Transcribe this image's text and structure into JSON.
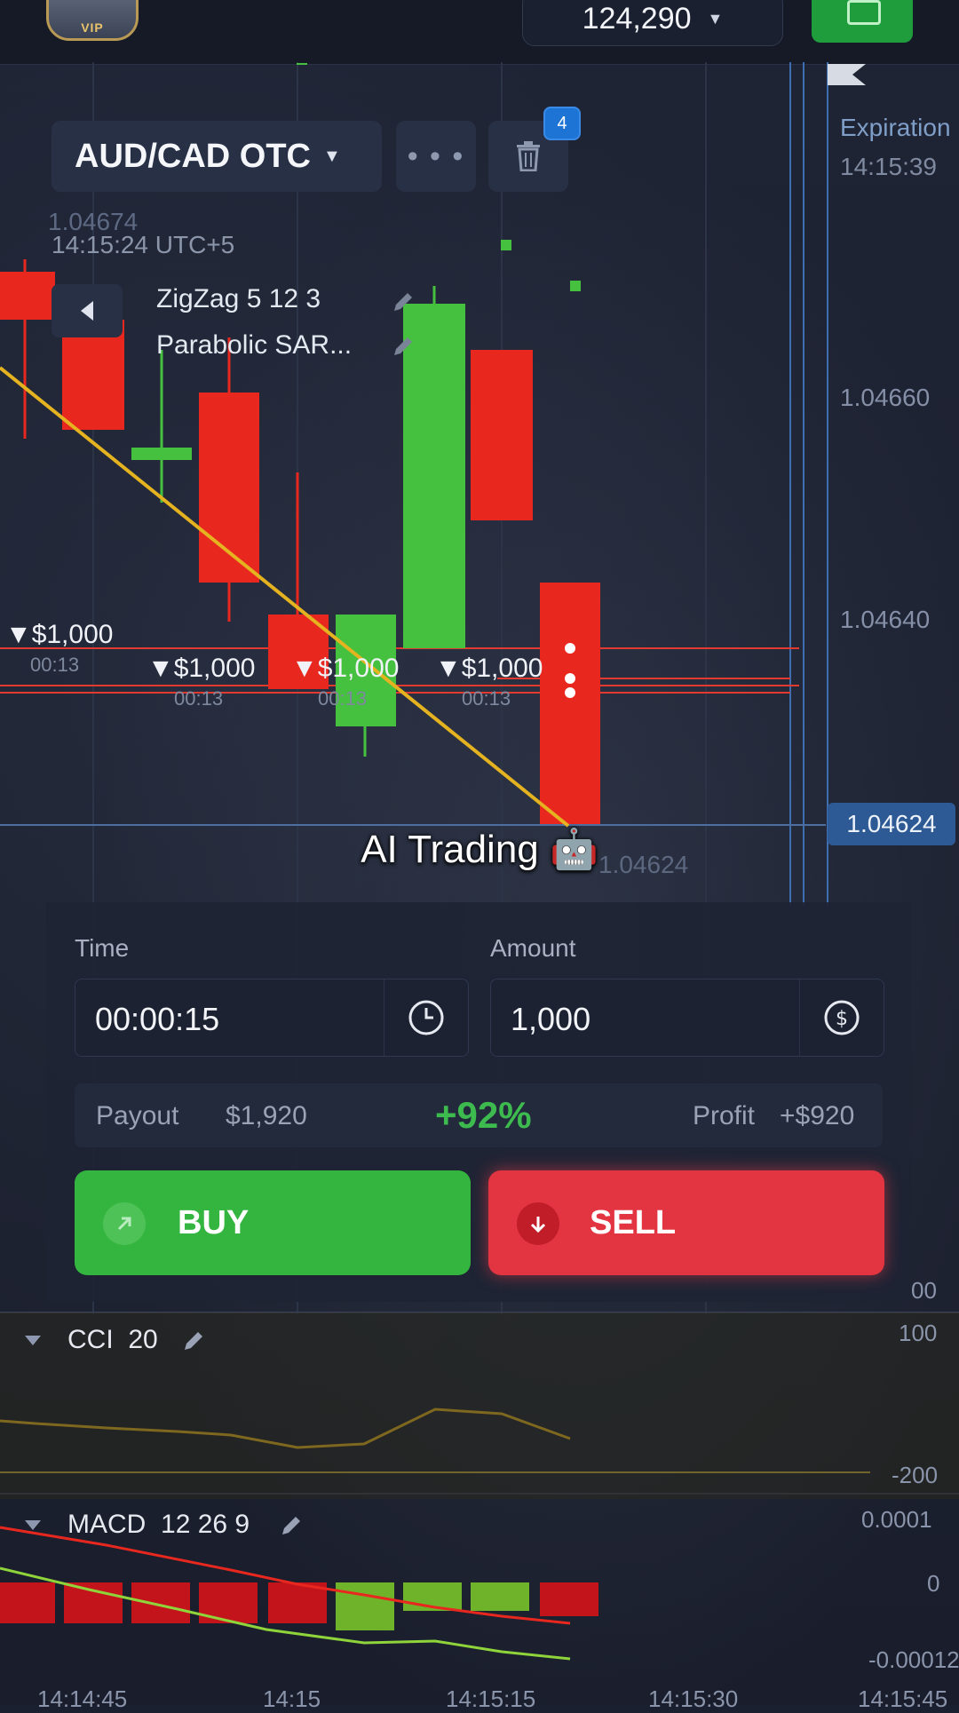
{
  "header": {
    "balance": "124,290",
    "vip_label": "VIP"
  },
  "asset": {
    "name": "AUD/CAD OTC",
    "menu_dots": "• • •",
    "badge_count": "4"
  },
  "expiration": {
    "label": "Expiration",
    "time": "14:15:39"
  },
  "chart_info": {
    "price_top": "1.04674",
    "timestamp": "14:15:24 UTC+5"
  },
  "indicators_overlay": [
    "ZigZag 5 12 3",
    "Parabolic SAR..."
  ],
  "price_axis": [
    "1.04660",
    "1.04640",
    "1.04624"
  ],
  "price_current": "1.04624",
  "price_ghost": "1.04624",
  "bets": [
    {
      "amount": "▼$1,000",
      "time": "00:13"
    },
    {
      "amount": "▼$1,000",
      "time": "00:13"
    },
    {
      "amount": "▼$1,000",
      "time": "00:13"
    },
    {
      "amount": "▼$1,000",
      "time": "00:13"
    }
  ],
  "overlay_title": "AI Trading 🤖",
  "trade": {
    "time_label": "Time",
    "time_value": "00:00:15",
    "amount_label": "Amount",
    "amount_value": "1,000",
    "payout_label": "Payout",
    "payout_value": "$1,920",
    "payout_pct": "+92%",
    "profit_label": "Profit",
    "profit_value": "+$920",
    "buy_label": "BUY",
    "sell_label": "SELL"
  },
  "cci": {
    "title": "CCI",
    "period": "20",
    "axis": [
      "00",
      "100",
      "-200"
    ]
  },
  "macd": {
    "title": "MACD",
    "params": "12 26 9",
    "axis": [
      "0.0001",
      "0",
      "-0.00012"
    ]
  },
  "time_axis": [
    "14:14:45",
    "14:15",
    "14:15:15",
    "14:15:30",
    "14:15:45"
  ],
  "colors": {
    "up": "#45c13f",
    "down": "#e8271f",
    "buy": "#34b53f",
    "sell": "#e23441",
    "accent": "#2d5a94"
  }
}
